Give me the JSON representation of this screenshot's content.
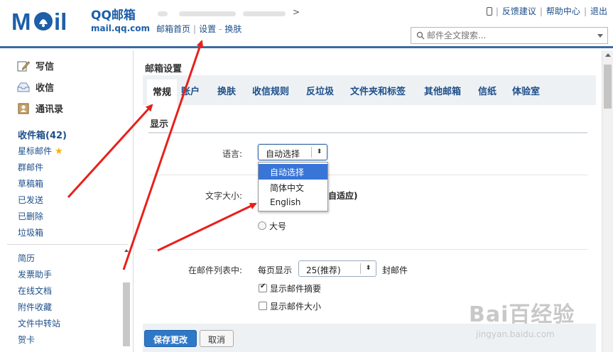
{
  "header": {
    "logo_text": "MOil",
    "brand_title": "QQ邮箱",
    "brand_domain": "mail.qq.com",
    "user_suffix": ">",
    "nav": {
      "home": "邮箱首页",
      "sep": "|",
      "settings": "设置",
      "dash": "-",
      "skin": "换肤"
    },
    "top_links": {
      "feedback": "反馈建议",
      "help": "帮助中心",
      "logout": "退出",
      "sep": "|"
    },
    "search_placeholder": "邮件全文搜索..."
  },
  "sidebar": {
    "compose": "写信",
    "receive": "收信",
    "contacts": "通讯录",
    "folders": [
      "收件箱(42)",
      "星标邮件",
      "群邮件",
      "草稿箱",
      "已发送",
      "已删除",
      "垃圾箱"
    ],
    "tools": [
      "简历",
      "发票助手",
      "在线文档",
      "附件收藏",
      "文件中转站",
      "贺卡"
    ]
  },
  "main": {
    "title": "邮箱设置",
    "tabs": [
      "常规",
      "账户",
      "换肤",
      "收信规则",
      "反垃圾",
      "文件夹和标签",
      "其他邮箱",
      "信纸",
      "体验室"
    ],
    "section_display": "显示",
    "language": {
      "label": "语言:",
      "value": "自动选择",
      "arrow": "⬍",
      "options": [
        "自动选择",
        "简体中文",
        "English"
      ],
      "selected_index": 0
    },
    "font_size": {
      "label": "文字大小:",
      "partial_text": "自适应)",
      "large_label": "大号"
    },
    "mail_list": {
      "label": "在邮件列表中:",
      "per_page_prefix": "每页显示",
      "per_page_value": "25(推荐)",
      "per_page_suffix": "封邮件",
      "show_summary": "显示邮件摘要",
      "show_summary_checked": true,
      "show_size": "显示邮件大小",
      "show_size_checked": false
    },
    "buttons": {
      "save": "保存更改",
      "cancel": "取消"
    }
  },
  "watermark": {
    "brand": "Bai百经验",
    "url": "jingyan.baidu.com"
  },
  "colors": {
    "brand_blue": "#1d5fa8",
    "header_border": "#3c6aa0",
    "highlight": "#3875d7",
    "arrow_red": "#e8201b"
  }
}
